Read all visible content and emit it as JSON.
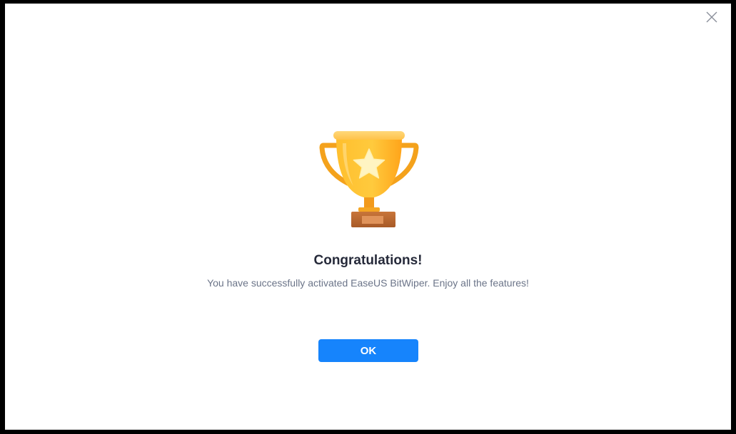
{
  "dialog": {
    "close_icon": "close-icon",
    "trophy_icon": "trophy-icon",
    "title": "Congratulations!",
    "message": "You have successfully activated EaseUS BitWiper. Enjoy all the features!",
    "ok_label": "OK"
  },
  "colors": {
    "accent": "#1684fc",
    "title": "#262a3a",
    "message": "#6b7488",
    "trophy_gold": "#ffb21c",
    "trophy_base": "#b9652e"
  }
}
